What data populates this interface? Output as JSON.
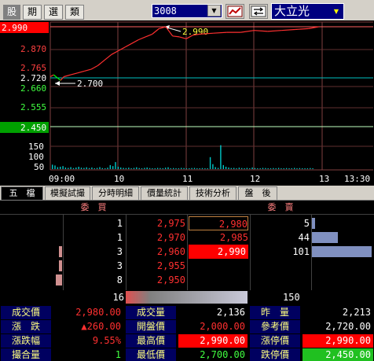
{
  "toolbar": {
    "tab_stock": "股",
    "tab_period": "期",
    "tab_select": "選",
    "tab_category": "類",
    "stock_code": "3008",
    "stock_name": "大立光"
  },
  "chart_data": {
    "type": "line",
    "price_labels": [
      "2.990",
      "2.870",
      "2.765",
      "2.720",
      "2.660",
      "2.555",
      "2.450"
    ],
    "volume_labels": [
      "150",
      "100",
      "50"
    ],
    "time_labels": [
      "09:00",
      "10",
      "11",
      "12",
      "13",
      "13:30"
    ],
    "annotation_high": "2.990",
    "annotation_low": "2.700",
    "reference_price": 2.72,
    "ylim": [
      2.45,
      2.99
    ],
    "price_series": {
      "x": [
        0,
        0.05,
        0.1,
        0.15,
        0.2,
        0.3,
        0.4,
        0.5,
        0.6,
        0.7,
        0.8,
        0.9,
        1.0,
        1.1,
        1.2,
        1.3,
        1.4,
        1.5,
        1.6,
        1.7,
        1.8,
        1.9,
        2.0,
        2.1,
        2.2,
        2.4,
        2.6,
        2.8,
        3.0,
        3.2,
        3.4,
        3.6,
        3.8,
        3.95
      ],
      "y": [
        2.72,
        2.73,
        2.715,
        2.7,
        2.72,
        2.73,
        2.74,
        2.75,
        2.76,
        2.78,
        2.81,
        2.84,
        2.86,
        2.88,
        2.9,
        2.92,
        2.935,
        2.95,
        2.98,
        2.99,
        2.94,
        2.935,
        2.925,
        2.945,
        2.95,
        2.955,
        2.96,
        2.96,
        2.97,
        2.965,
        2.97,
        2.975,
        2.98,
        2.99
      ]
    },
    "volume_series": {
      "values": [
        22,
        18,
        10,
        12,
        15,
        8,
        6,
        10,
        5,
        8,
        12,
        7,
        6,
        9,
        5,
        8,
        4,
        6,
        10,
        5,
        4,
        7,
        20,
        15,
        35,
        12,
        8,
        6,
        5,
        7,
        4,
        6,
        9,
        5,
        4,
        6,
        8,
        5,
        3,
        4,
        6,
        5,
        3,
        7,
        9,
        4,
        5,
        3,
        4,
        6,
        5,
        3,
        4,
        5,
        6,
        4,
        3,
        5,
        4,
        3,
        60,
        25,
        10,
        6,
        120,
        20,
        12,
        8,
        5,
        6,
        4,
        7,
        5,
        3,
        6,
        4,
        8,
        5,
        3,
        4,
        6,
        5,
        4,
        3,
        5,
        4,
        6,
        3,
        4,
        5,
        3,
        4,
        6,
        3,
        5,
        4,
        3,
        4,
        5,
        3
      ]
    }
  },
  "tabs": [
    "五　檔",
    "模擬試撮",
    "分時明細",
    "價量統計",
    "技術分析",
    "盤　後"
  ],
  "book": {
    "bid_header": "委　買",
    "ask_header": "委　賣",
    "rows": [
      {
        "bid_qty": "1",
        "bid_price": "2,975",
        "ask_price": "2,980",
        "ask_qty": "5"
      },
      {
        "bid_qty": "1",
        "bid_price": "2,970",
        "ask_price": "2,985",
        "ask_qty": "44"
      },
      {
        "bid_qty": "3",
        "bid_price": "2,960",
        "ask_price": "2,990",
        "ask_qty": "101"
      },
      {
        "bid_qty": "3",
        "bid_price": "2,955",
        "ask_price": "",
        "ask_qty": ""
      },
      {
        "bid_qty": "8",
        "bid_price": "2,950",
        "ask_price": "",
        "ask_qty": ""
      }
    ],
    "bid_qty_fractions": [
      0.02,
      0.02,
      0.05,
      0.05,
      0.1
    ],
    "ask_qty_fractions": [
      0.05,
      0.44,
      1.0
    ],
    "bid_total": "16",
    "ask_total": "150"
  },
  "stats": {
    "row1": {
      "l1": "成交價",
      "v1": "2,980.00",
      "l2": "成交量",
      "v2": "2,136",
      "l3": "昨　量",
      "v3": "2,213"
    },
    "row2": {
      "l1": "漲　跌",
      "v1": "▲260.00",
      "l2": "開盤價",
      "v2": "2,000.00",
      "l3": "參考價",
      "v3": "2,720.00"
    },
    "row3": {
      "l1": "漲跌幅",
      "v1": "9.55%",
      "l2": "最高價",
      "v2": "2,990.00",
      "l3": "漲停價",
      "v3": "2,990.00"
    },
    "row4": {
      "l1": "撮合量",
      "v1": "1",
      "l2": "最低價",
      "v2": "2,700.00",
      "l3": "跌停價",
      "v3": "2,450.00"
    }
  },
  "colors": {
    "up": "#ff3030",
    "down": "#00ff00",
    "limit_up_bg": "#ff0000",
    "limit_down_bg": "#00a000",
    "volume_bar": "#00c8c8"
  }
}
